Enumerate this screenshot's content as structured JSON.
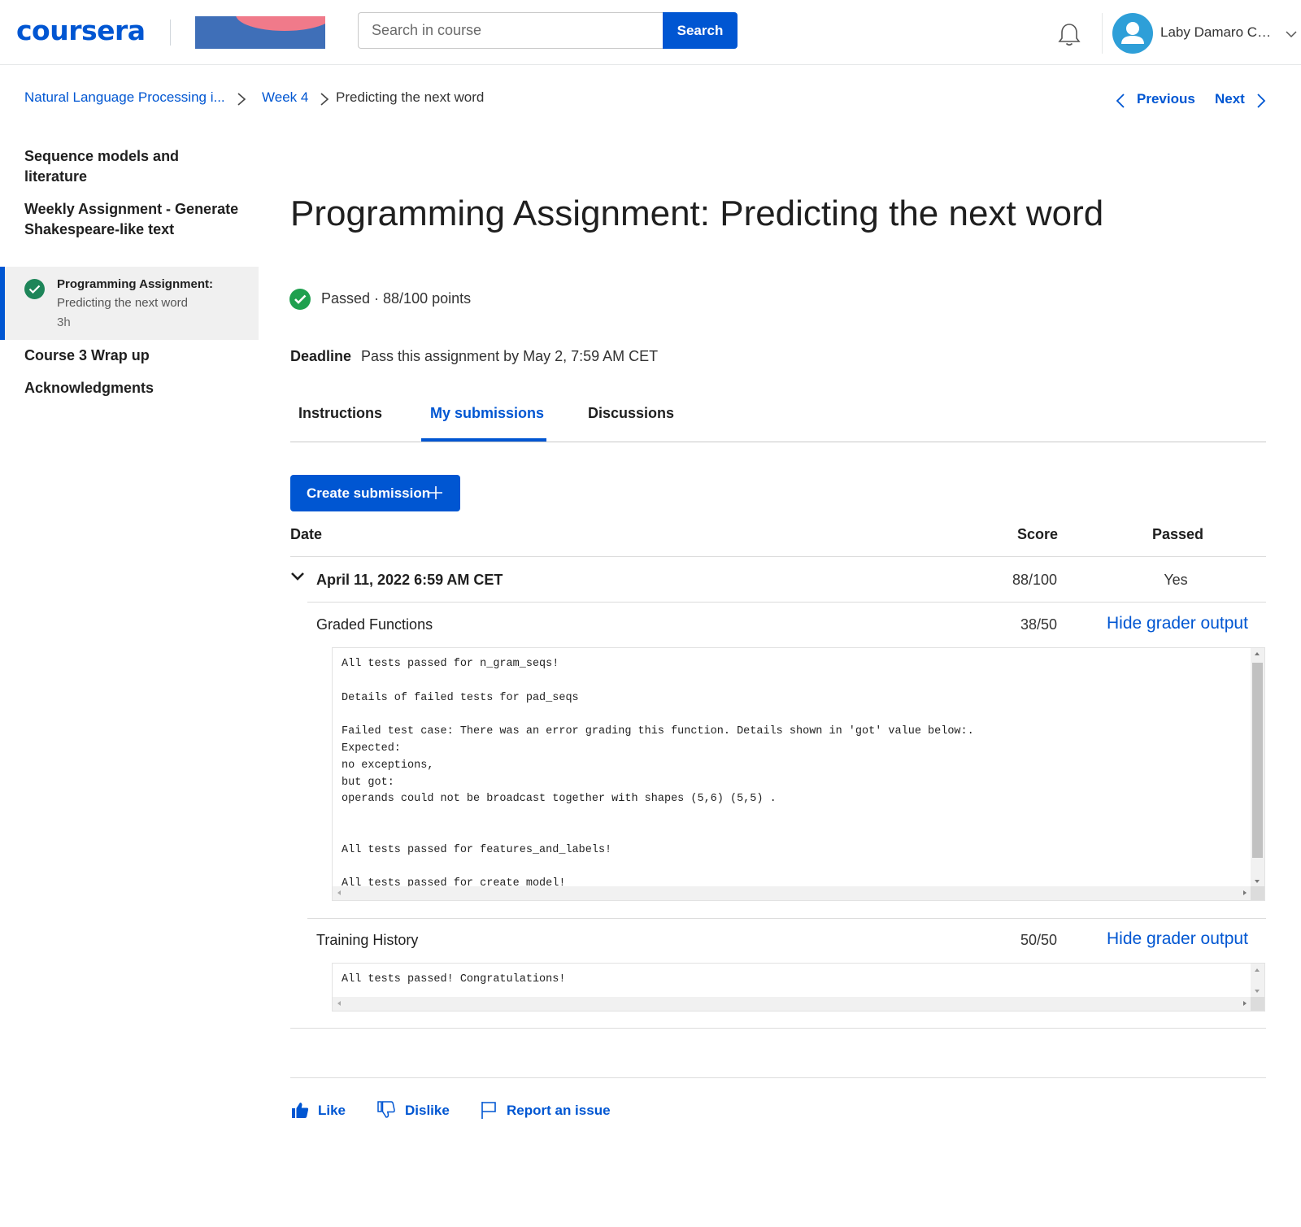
{
  "header": {
    "logo_text": "coursera",
    "search_placeholder": "Search in course",
    "search_button": "Search",
    "user_name": "Laby Damaro Ca..."
  },
  "breadcrumb": {
    "course": "Natural Language Processing i...",
    "week": "Week 4",
    "current": "Predicting the next word"
  },
  "pager": {
    "previous": "Previous",
    "next": "Next"
  },
  "sidebar": {
    "items": [
      {
        "label": "Sequence models and literature"
      },
      {
        "label": "Weekly Assignment - Generate Shakespeare-like text"
      }
    ],
    "active_item": {
      "title": "Programming Assignment:",
      "subtitle": "Predicting the next word",
      "duration": "3h"
    },
    "after_items": [
      {
        "label": "Course 3 Wrap up"
      },
      {
        "label": "Acknowledgments"
      }
    ]
  },
  "main": {
    "title": "Programming Assignment: Predicting the next word",
    "status": "Passed · 88/100 points",
    "deadline_label": "Deadline",
    "deadline_text": "Pass this assignment by May 2, 7:59 AM CET",
    "tabs": [
      {
        "label": "Instructions"
      },
      {
        "label": "My submissions"
      },
      {
        "label": "Discussions"
      }
    ],
    "active_tab": "My submissions",
    "create_button": "Create submission"
  },
  "submissions": {
    "columns": {
      "date": "Date",
      "score": "Score",
      "passed": "Passed"
    },
    "rows": [
      {
        "date": "April 11, 2022 6:59 AM CET",
        "score": "88/100",
        "passed": "Yes",
        "parts": [
          {
            "name": "Graded Functions",
            "score": "38/50",
            "toggle": "Hide grader output",
            "output": "All tests passed for n_gram_seqs!\n\nDetails of failed tests for pad_seqs\n\nFailed test case: There was an error grading this function. Details shown in 'got' value below:.\nExpected:\nno exceptions,\nbut got:\noperands could not be broadcast together with shapes (5,6) (5,5) .\n\n\nAll tests passed for features_and_labels!\n\nAll tests passed for create_model!"
          },
          {
            "name": "Training History",
            "score": "50/50",
            "toggle": "Hide grader output",
            "output": "All tests passed! Congratulations!"
          }
        ]
      }
    ]
  },
  "feedback": {
    "like": "Like",
    "dislike": "Dislike",
    "report": "Report an issue"
  },
  "colors": {
    "brand": "#0056d2",
    "success": "#1fa04f"
  },
  "icons": [
    "bell-icon",
    "avatar-icon",
    "chevron-down-icon",
    "chevron-right-icon",
    "chevron-left-icon",
    "check-circle-icon",
    "plus-icon",
    "thumbs-up-icon",
    "thumbs-down-icon",
    "flag-icon"
  ]
}
